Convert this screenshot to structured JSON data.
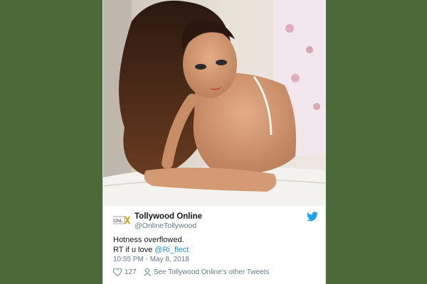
{
  "tweet": {
    "display_name": "Tollywood Online",
    "handle": "@OnlineTollywood",
    "text_line1": "Hotness overflowed.",
    "text_line2_prefix": "RT if u love ",
    "mention": "@Ri_flect",
    "timestamp": "10:55 PM - May 8, 2018",
    "likes": "127",
    "see_more_label": "See Tollywood Online's other Tweets",
    "photo_alt": "photo"
  },
  "icons": {
    "avatar": "logo-icon",
    "brand": "twitter-bird-icon",
    "like": "heart-icon",
    "profile": "person-icon"
  },
  "colors": {
    "page_background": "#4a6a3a",
    "link": "#1b95e0",
    "brand": "#1da1f2",
    "text": "#14171a",
    "muted": "#657786"
  }
}
